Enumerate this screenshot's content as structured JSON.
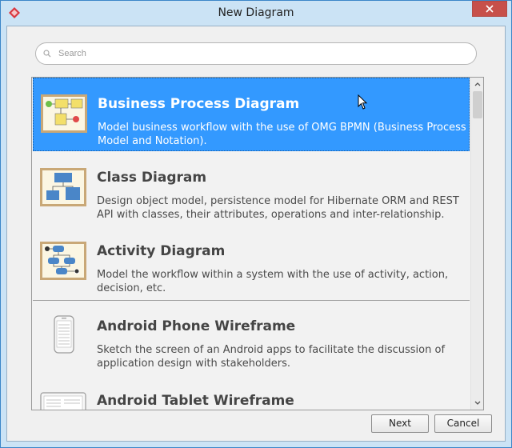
{
  "window": {
    "title": "New Diagram"
  },
  "search": {
    "placeholder": "Search"
  },
  "diagrams": [
    {
      "name": "Business Process Diagram",
      "description": "Model business workflow with the use of OMG BPMN (Business Process Model and Notation).",
      "icon": "bpmn-diagram-icon",
      "selected": true
    },
    {
      "name": "Class Diagram",
      "description": "Design object model, persistence model for Hibernate ORM and REST API with classes, their attributes, operations and inter-relationship.",
      "icon": "class-diagram-icon",
      "selected": false
    },
    {
      "name": "Activity Diagram",
      "description": "Model the workflow within a system with the use of activity, action, decision, etc.",
      "icon": "activity-diagram-icon",
      "selected": false
    },
    {
      "name": "Android Phone Wireframe",
      "description": "Sketch the screen of an Android apps to facilitate the discussion of application design with stakeholders.",
      "icon": "android-phone-icon",
      "selected": false
    },
    {
      "name": "Android Tablet Wireframe",
      "description": "",
      "icon": "android-tablet-icon",
      "selected": false
    }
  ],
  "buttons": {
    "next": "Next",
    "cancel": "Cancel"
  },
  "colors": {
    "selection": "#3399ff",
    "title_bar": "#cbe3f5",
    "close": "#c7504a"
  }
}
